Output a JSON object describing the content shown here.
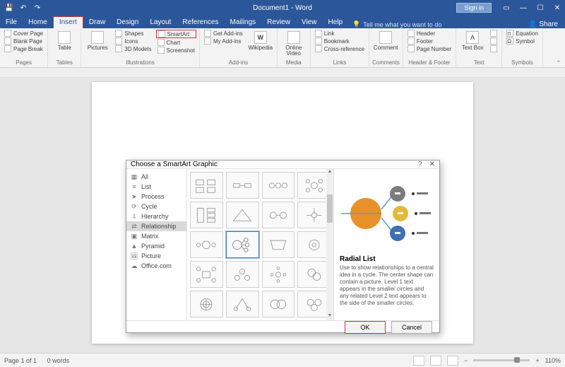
{
  "title": "Document1 - Word",
  "signin": "Sign in",
  "tabs": [
    "File",
    "Home",
    "Insert",
    "Draw",
    "Design",
    "Layout",
    "References",
    "Mailings",
    "Review",
    "View",
    "Help"
  ],
  "active_tab": "Insert",
  "tell_me": "Tell me what you want to do",
  "share": "Share",
  "ribbon": {
    "pages": {
      "cover": "Cover Page",
      "blank": "Blank Page",
      "break": "Page Break",
      "label": "Pages"
    },
    "tables": {
      "table": "Table",
      "label": "Tables"
    },
    "illus": {
      "pictures": "Pictures",
      "shapes": "Shapes",
      "icons": "Icons",
      "models": "3D Models",
      "smartart": "SmartArt",
      "chart": "Chart",
      "screenshot": "Screenshot",
      "label": "Illustrations"
    },
    "addins": {
      "get": "Get Add-ins",
      "my": "My Add-ins",
      "wiki": "Wikipedia",
      "label": "Add-ins"
    },
    "media": {
      "video": "Online Video",
      "label": "Media"
    },
    "links": {
      "link": "Link",
      "bookmark": "Bookmark",
      "xref": "Cross-reference",
      "label": "Links"
    },
    "comments": {
      "comment": "Comment",
      "label": "Comments"
    },
    "hf": {
      "header": "Header",
      "footer": "Footer",
      "pagen": "Page Number",
      "label": "Header & Footer"
    },
    "text": {
      "textbox": "Text Box",
      "label": "Text"
    },
    "symbols": {
      "eq": "Equation",
      "sym": "Symbol",
      "label": "Symbols"
    }
  },
  "dialog": {
    "title": "Choose a SmartArt Graphic",
    "nav": [
      "All",
      "List",
      "Process",
      "Cycle",
      "Hierarchy",
      "Relationship",
      "Matrix",
      "Pyramid",
      "Picture",
      "Office.com"
    ],
    "selected_nav": "Relationship",
    "preview_title": "Radial List",
    "preview_desc": "Use to show relationships to a central idea in a cycle. The center shape can contain a picture. Level 1 text appears in the smaller circles and any related Level 2 text appears to the side of the smaller circles.",
    "ok": "OK",
    "cancel": "Cancel"
  },
  "status": {
    "page": "Page 1 of 1",
    "words": "0 words",
    "zoom": "110%"
  }
}
